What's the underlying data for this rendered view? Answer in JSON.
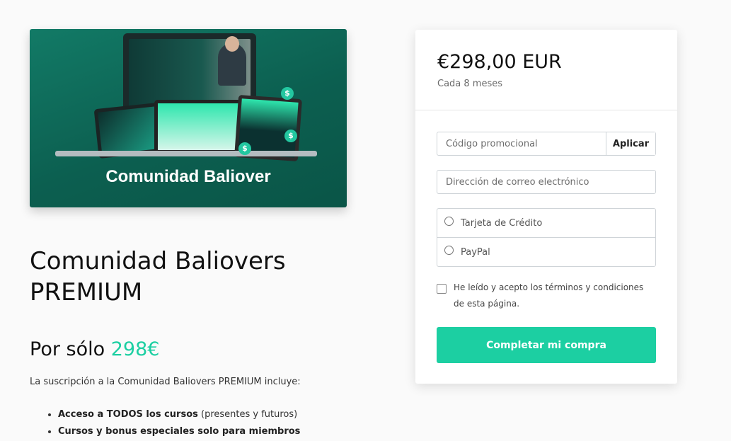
{
  "hero": {
    "caption": "Comunidad Baliover"
  },
  "product": {
    "title": "Comunidad Baliovers PREMIUM",
    "price_prefix": "Por sólo",
    "price_value": "298€",
    "includes_text": "La suscripción a la Comunidad Baliovers PREMIUM incluye:",
    "benefits": [
      {
        "bold": "Acceso a TODOS los cursos",
        "rest": " (presentes y futuros)"
      },
      {
        "bold": "Cursos y bonus especiales solo para miembros",
        "rest": ""
      }
    ]
  },
  "checkout": {
    "amount": "€298,00 EUR",
    "period": "Cada 8 meses",
    "promo_placeholder": "Código promocional",
    "promo_button": "Aplicar",
    "email_placeholder": "Dirección de correo electrónico",
    "payment_options": [
      "Tarjeta de Crédito",
      "PayPal"
    ],
    "terms_label": "He leído y acepto los términos y condiciones de esta página.",
    "submit_label": "Completar mi compra"
  },
  "colors": {
    "accent": "#1ccfa2",
    "hero_bg": "#0c5f50"
  }
}
